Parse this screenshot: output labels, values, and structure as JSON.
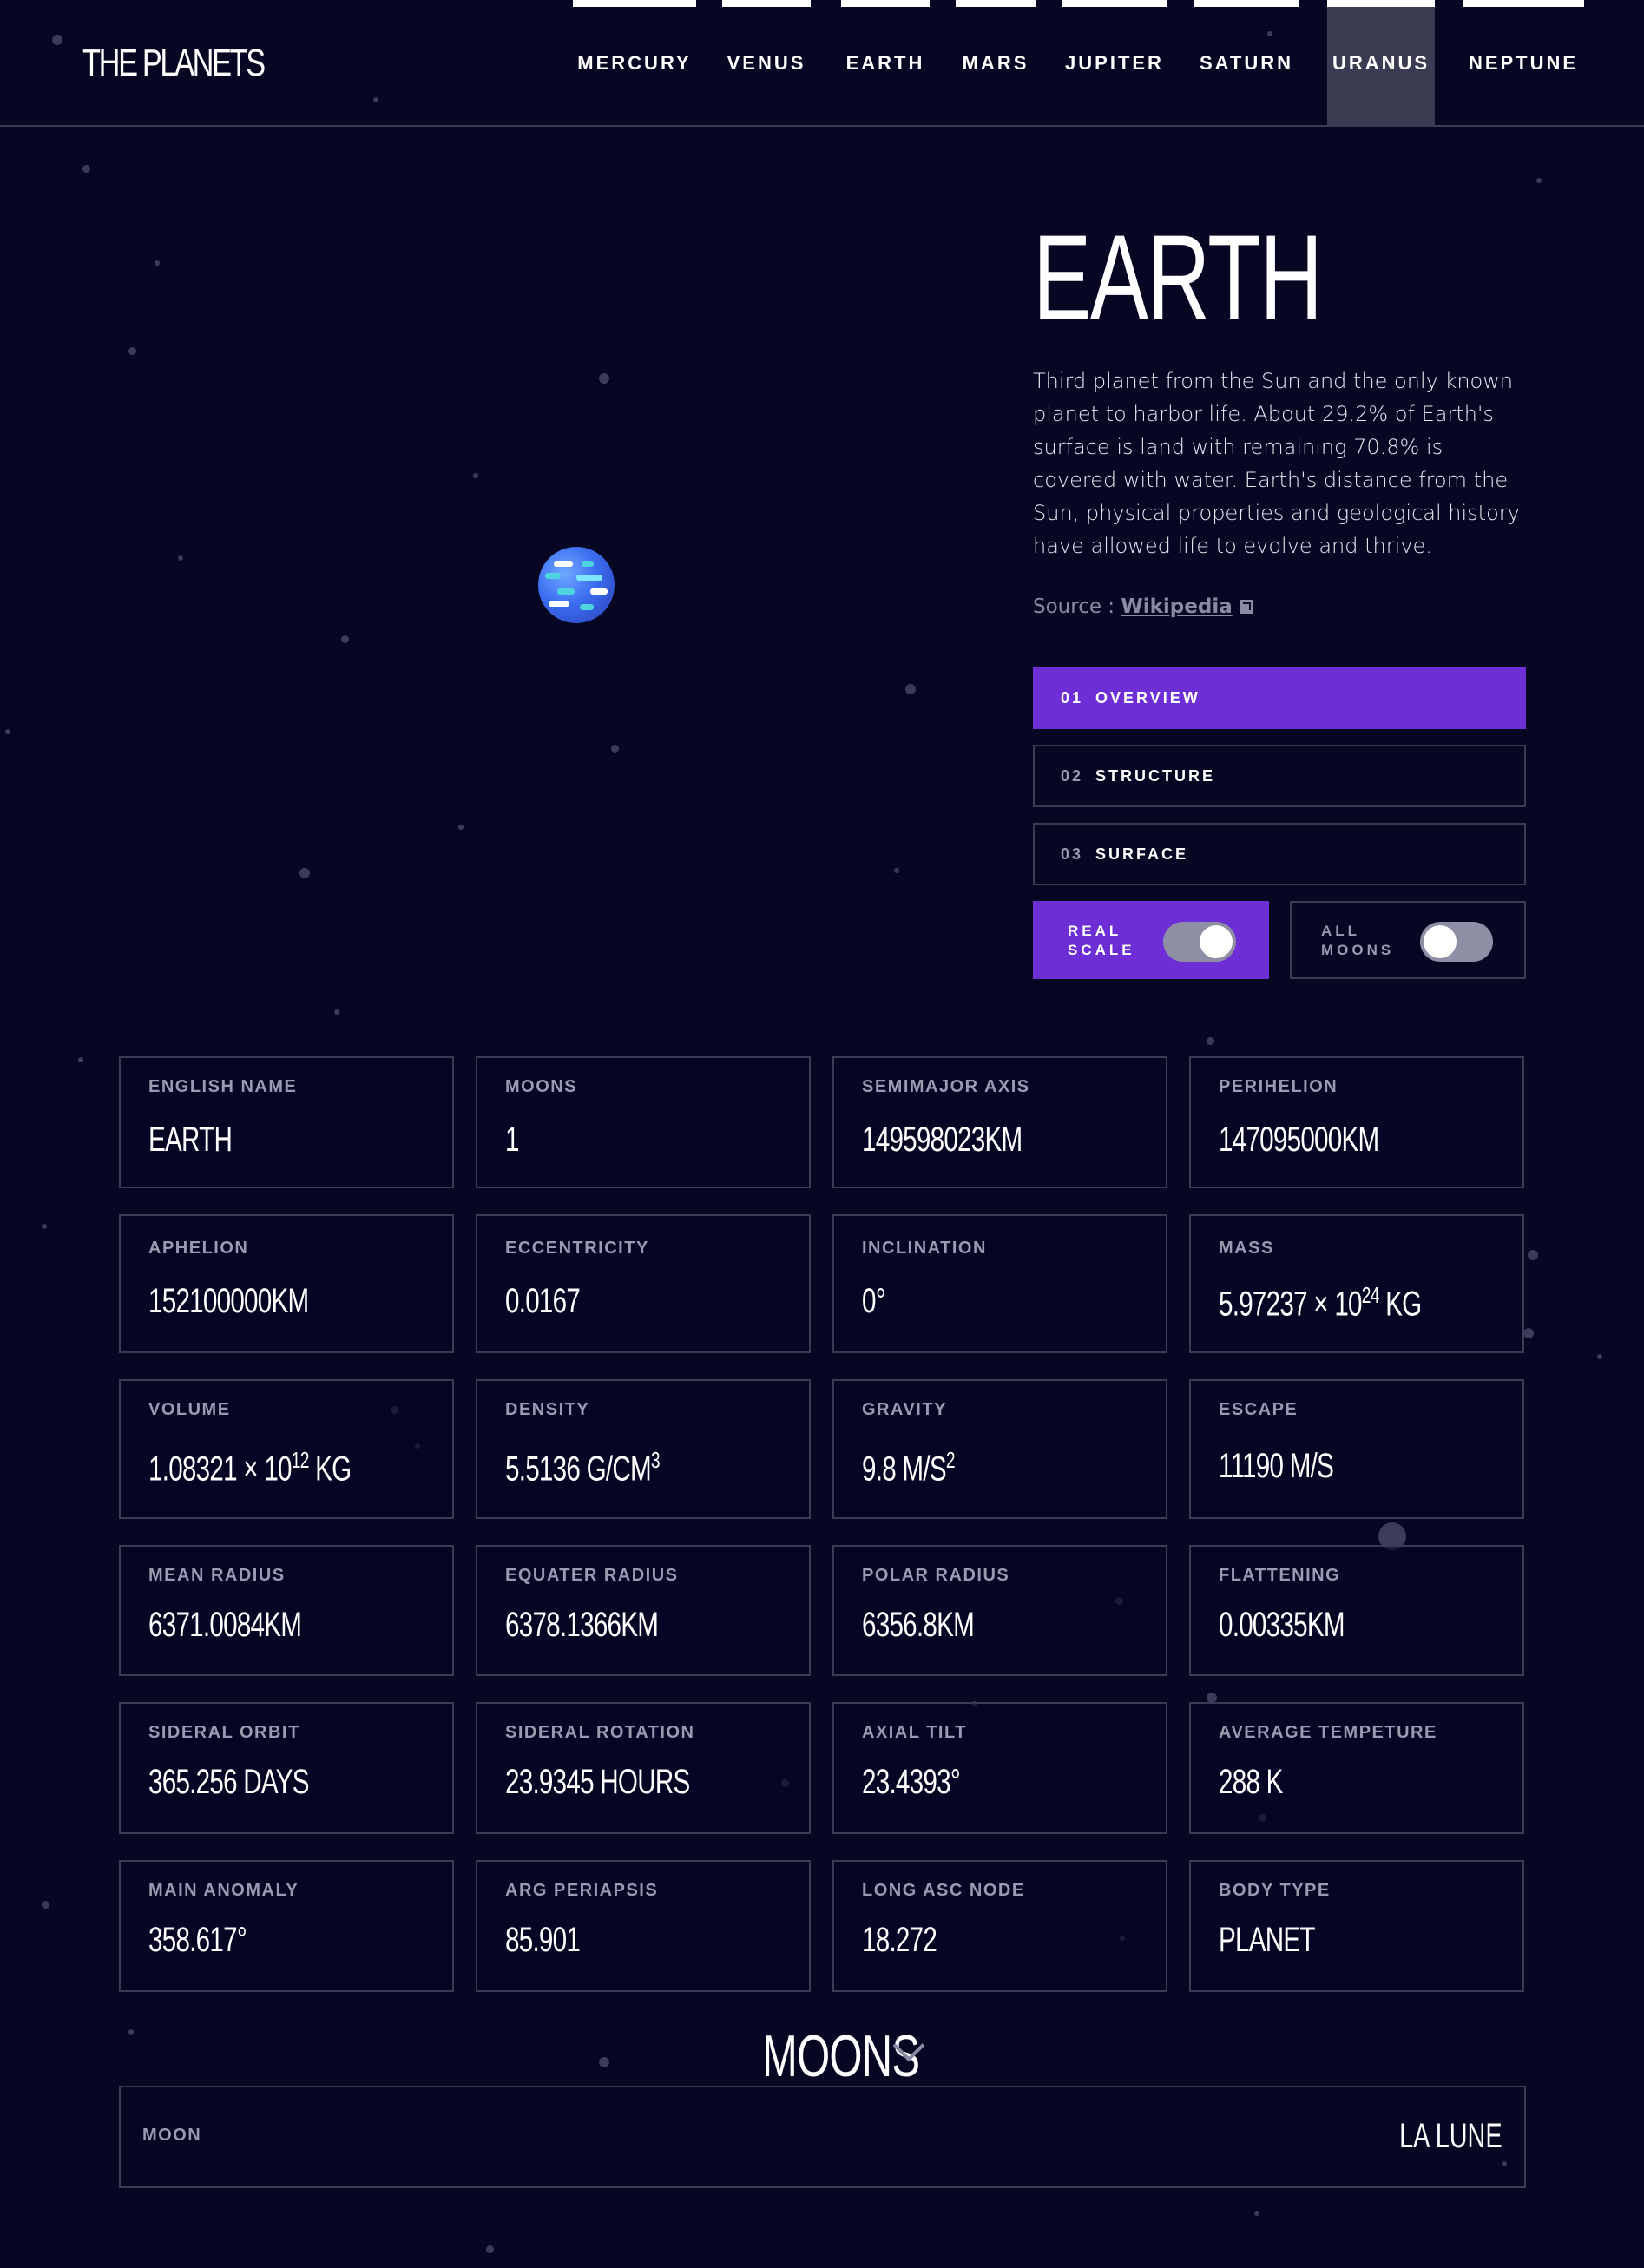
{
  "app": {
    "logo": "THE PLANETS"
  },
  "nav": {
    "items": [
      {
        "label": "MERCURY"
      },
      {
        "label": "VENUS"
      },
      {
        "label": "EARTH"
      },
      {
        "label": "MARS"
      },
      {
        "label": "JUPITER"
      },
      {
        "label": "SATURN"
      },
      {
        "label": "URANUS"
      },
      {
        "label": "NEPTUNE"
      }
    ],
    "active": "URANUS"
  },
  "planet": {
    "name": "EARTH",
    "description": "Third planet from the Sun and the only known planet to harbor life. About 29.2% of Earth's surface is land with remaining 70.8% is covered with water. Earth's distance from the Sun, physical properties and geological history have allowed life to evolve and thrive.",
    "source_prefix": "Source : ",
    "source_link": "Wikipedia",
    "image_icon": "planet-earth-icon"
  },
  "tabs": [
    {
      "num": "01",
      "label": "OVERVIEW",
      "active": true
    },
    {
      "num": "02",
      "label": "STRUCTURE",
      "active": false
    },
    {
      "num": "03",
      "label": "SURFACE",
      "active": false
    }
  ],
  "toggles": [
    {
      "label_line1": "REAL",
      "label_line2": "SCALE",
      "state": "on"
    },
    {
      "label_line1": "ALL",
      "label_line2": "MOONS",
      "state": "off"
    }
  ],
  "stats": [
    {
      "label": "ENGLISH NAME",
      "value": "EARTH"
    },
    {
      "label": "MOONS",
      "value": "1"
    },
    {
      "label": "SEMIMAJOR AXIS",
      "value": "149598023KM"
    },
    {
      "label": "PERIHELION",
      "value": "147095000KM"
    },
    {
      "label": "APHELION",
      "value": "152100000KM"
    },
    {
      "label": "ECCENTRICITY",
      "value": "0.0167"
    },
    {
      "label": "INCLINATION",
      "value": "0°"
    },
    {
      "label": "MASS",
      "value": "5.97237 × 10",
      "sup": "24",
      "suffix": " KG"
    },
    {
      "label": "VOLUME",
      "value": "1.08321 × 10",
      "sup": "12",
      "suffix": " KG"
    },
    {
      "label": "DENSITY",
      "value": "5.5136 G/CM",
      "sup": "3",
      "suffix": ""
    },
    {
      "label": "GRAVITY",
      "value": "9.8 M/S",
      "sup": "2",
      "suffix": ""
    },
    {
      "label": "ESCAPE",
      "value": "11190 M/S"
    },
    {
      "label": "MEAN RADIUS",
      "value": "6371.0084KM"
    },
    {
      "label": "EQUATER RADIUS",
      "value": "6378.1366KM"
    },
    {
      "label": "POLAR RADIUS",
      "value": "6356.8KM"
    },
    {
      "label": "FLATTENING",
      "value": "0.00335KM"
    },
    {
      "label": "SIDERAL ORBIT",
      "value": "365.256 DAYS"
    },
    {
      "label": "SIDERAL ROTATION",
      "value": "23.9345 HOURS"
    },
    {
      "label": "AXIAL TILT",
      "value": "23.4393°"
    },
    {
      "label": "AVERAGE TEMPETURE",
      "value": "288 K"
    },
    {
      "label": "MAIN ANOMALY",
      "value": "358.617°"
    },
    {
      "label": "ARG PERIAPSIS",
      "value": "85.901"
    },
    {
      "label": "LONG ASC NODE",
      "value": "18.272"
    },
    {
      "label": "BODY TYPE",
      "value": "PLANET"
    }
  ],
  "moons": {
    "heading": "MOONS",
    "rows": [
      {
        "label": "MOON",
        "value": "LA LUNE"
      }
    ]
  },
  "colors": {
    "background": "#070724",
    "accent": "#6d2ed5",
    "border": "#3b3b52",
    "muted": "#9a9ab0"
  }
}
